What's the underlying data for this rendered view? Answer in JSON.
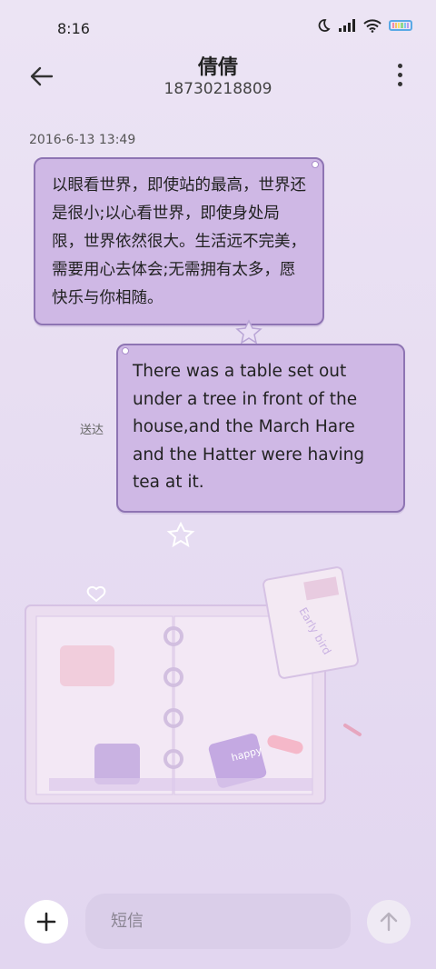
{
  "status_bar": {
    "time": "8:16"
  },
  "header": {
    "contact_name": "倩倩",
    "phone_number": "18730218809"
  },
  "conversation": {
    "timestamp": "2016-6-13 13:49",
    "incoming_message": "以眼看世界，即使站的最高，世界还是很小;以心看世界，即使身处局限，世界依然很大。生活远不完美，需要用心去体会;无需拥有太多，愿快乐与你相随。",
    "outgoing_message": "There was a table set out under a tree in front of the house,and the March Hare and the Hatter were having tea at it.",
    "delivery_status": "送达"
  },
  "illustration": {
    "tag_text": "Early bird",
    "sticker_text": "happy"
  },
  "composer": {
    "placeholder": "短信"
  },
  "colors": {
    "bubble": "#CFB8E5",
    "bubble_border": "#8E74B3",
    "background": "#E7DDF2"
  }
}
